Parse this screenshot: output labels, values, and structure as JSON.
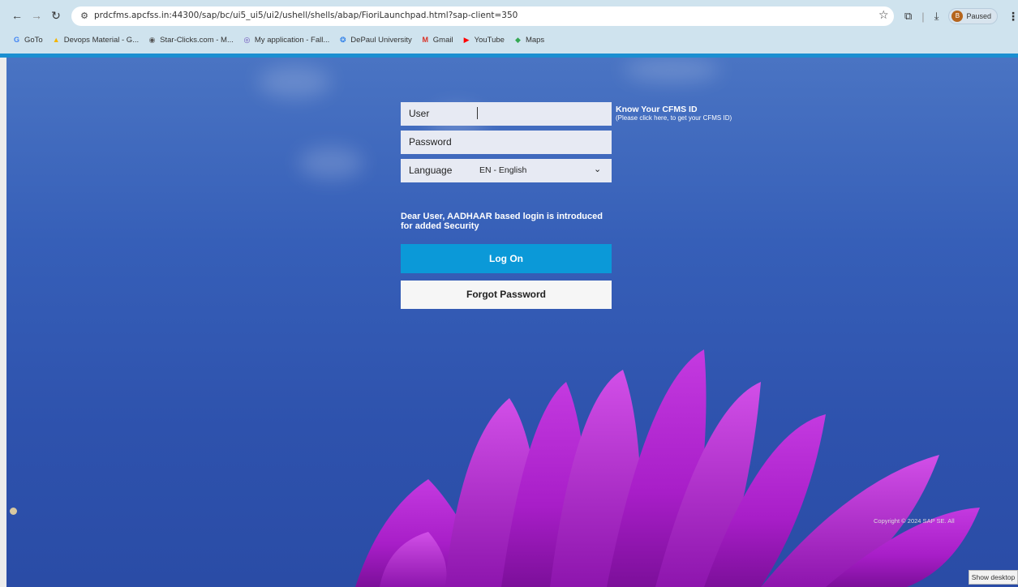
{
  "browser": {
    "url": "prdcfms.apcfss.in:44300/sap/bc/ui5_ui5/ui2/ushell/shells/abap/FioriLaunchpad.html?sap-client=350",
    "profile_initial": "B",
    "paused_label": "Paused",
    "bookmarks": [
      {
        "label": "GoTo",
        "icon": "google-icon",
        "color": "#4285f4"
      },
      {
        "label": "Devops Material - G...",
        "icon": "drive-icon",
        "color": "#f4b400"
      },
      {
        "label": "Star-Clicks.com - M...",
        "icon": "star-clicks-icon",
        "color": "#555555"
      },
      {
        "label": "My application - Fall...",
        "icon": "app-icon",
        "color": "#6b4fbb"
      },
      {
        "label": "DePaul University",
        "icon": "depaul-icon",
        "color": "#1a73e8"
      },
      {
        "label": "Gmail",
        "icon": "gmail-icon",
        "color": "#d93025"
      },
      {
        "label": "YouTube",
        "icon": "youtube-icon",
        "color": "#ff0000"
      },
      {
        "label": "Maps",
        "icon": "maps-icon",
        "color": "#34a853"
      }
    ]
  },
  "login": {
    "user_label": "User",
    "password_label": "Password",
    "language_label": "Language",
    "language_value": "EN - English",
    "know_title": "Know Your CFMS ID",
    "know_sub": "(Please click here, to get your CFMS ID)",
    "notice": "Dear User, AADHAAR based login is introduced for added Security",
    "logon_label": "Log On",
    "forgot_label": "Forgot Password"
  },
  "footer": {
    "copyright": "Copyright © 2024 SAP SE. All",
    "show_desktop": "Show desktop"
  },
  "colors": {
    "accent": "#0b99d8",
    "background": "#2f56b0",
    "flower": "#b52ad6"
  }
}
